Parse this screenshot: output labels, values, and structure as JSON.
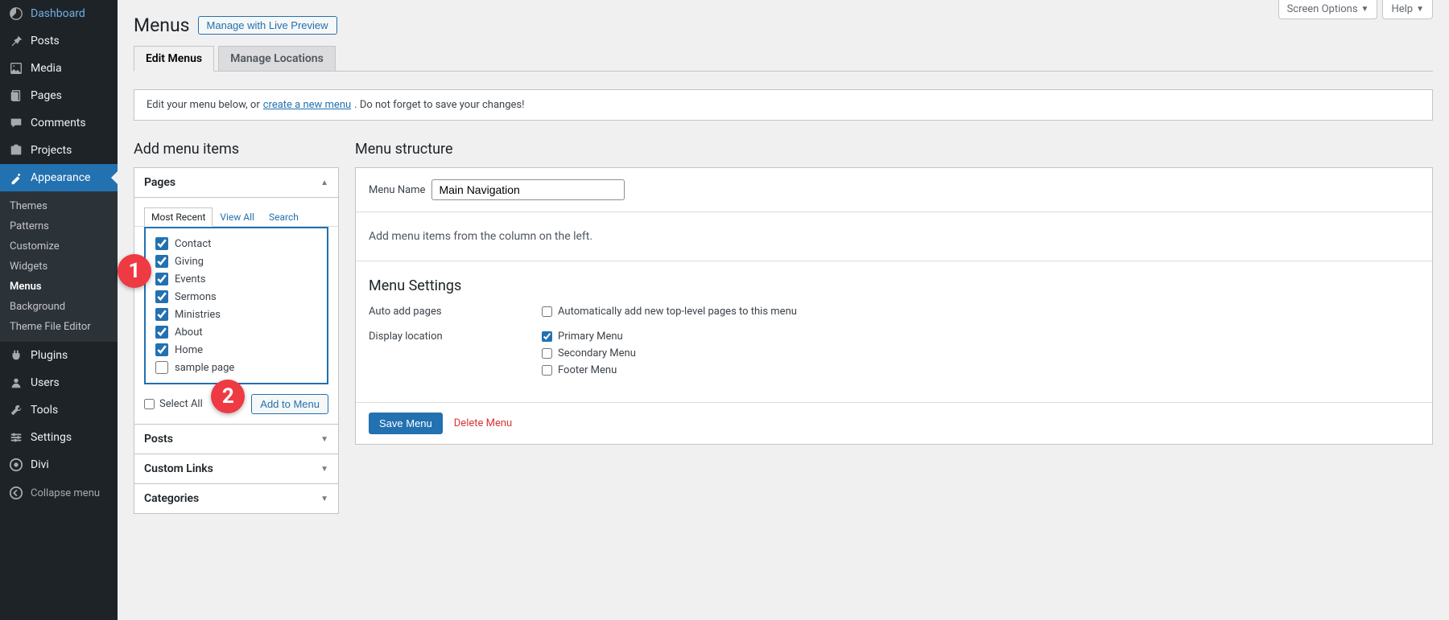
{
  "sidebar": {
    "items": [
      {
        "label": "Dashboard",
        "icon": "dashboard"
      },
      {
        "label": "Posts",
        "icon": "pin"
      },
      {
        "label": "Media",
        "icon": "media"
      },
      {
        "label": "Pages",
        "icon": "pages"
      },
      {
        "label": "Comments",
        "icon": "comments"
      },
      {
        "label": "Projects",
        "icon": "projects"
      },
      {
        "label": "Appearance",
        "icon": "appearance"
      },
      {
        "label": "Plugins",
        "icon": "plugins"
      },
      {
        "label": "Users",
        "icon": "users"
      },
      {
        "label": "Tools",
        "icon": "tools"
      },
      {
        "label": "Settings",
        "icon": "settings"
      },
      {
        "label": "Divi",
        "icon": "divi"
      }
    ],
    "sub": [
      "Themes",
      "Patterns",
      "Customize",
      "Widgets",
      "Menus",
      "Background",
      "Theme File Editor"
    ],
    "collapse": "Collapse menu"
  },
  "screen_meta": {
    "options": "Screen Options",
    "help": "Help"
  },
  "page": {
    "title": "Menus",
    "live_preview": "Manage with Live Preview",
    "tabs": {
      "edit": "Edit Menus",
      "locations": "Manage Locations"
    },
    "instruction_a": "Edit your menu below, or ",
    "instruction_link": "create a new menu",
    "instruction_b": ". Do not forget to save your changes!"
  },
  "left": {
    "heading": "Add menu items",
    "boxes": {
      "pages": "Pages",
      "posts": "Posts",
      "custom_links": "Custom Links",
      "categories": "Categories"
    },
    "inner_tabs": {
      "recent": "Most Recent",
      "all": "View All",
      "search": "Search"
    },
    "pages_list": [
      {
        "label": "Contact",
        "checked": true
      },
      {
        "label": "Giving",
        "checked": true
      },
      {
        "label": "Events",
        "checked": true
      },
      {
        "label": "Sermons",
        "checked": true
      },
      {
        "label": "Ministries",
        "checked": true
      },
      {
        "label": "About",
        "checked": true
      },
      {
        "label": "Home",
        "checked": true
      },
      {
        "label": "sample page",
        "checked": false
      }
    ],
    "select_all": "Select All",
    "add_to_menu": "Add to Menu"
  },
  "right": {
    "heading": "Menu structure",
    "name_label": "Menu Name",
    "name_value": "Main Navigation",
    "empty_msg": "Add menu items from the column on the left.",
    "settings_heading": "Menu Settings",
    "auto_add_label": "Auto add pages",
    "auto_add_opt": "Automatically add new top-level pages to this menu",
    "display_label": "Display location",
    "locations": [
      {
        "label": "Primary Menu",
        "checked": true
      },
      {
        "label": "Secondary Menu",
        "checked": false
      },
      {
        "label": "Footer Menu",
        "checked": false
      }
    ],
    "save": "Save Menu",
    "delete": "Delete Menu"
  },
  "badges": {
    "one": "1",
    "two": "2"
  }
}
